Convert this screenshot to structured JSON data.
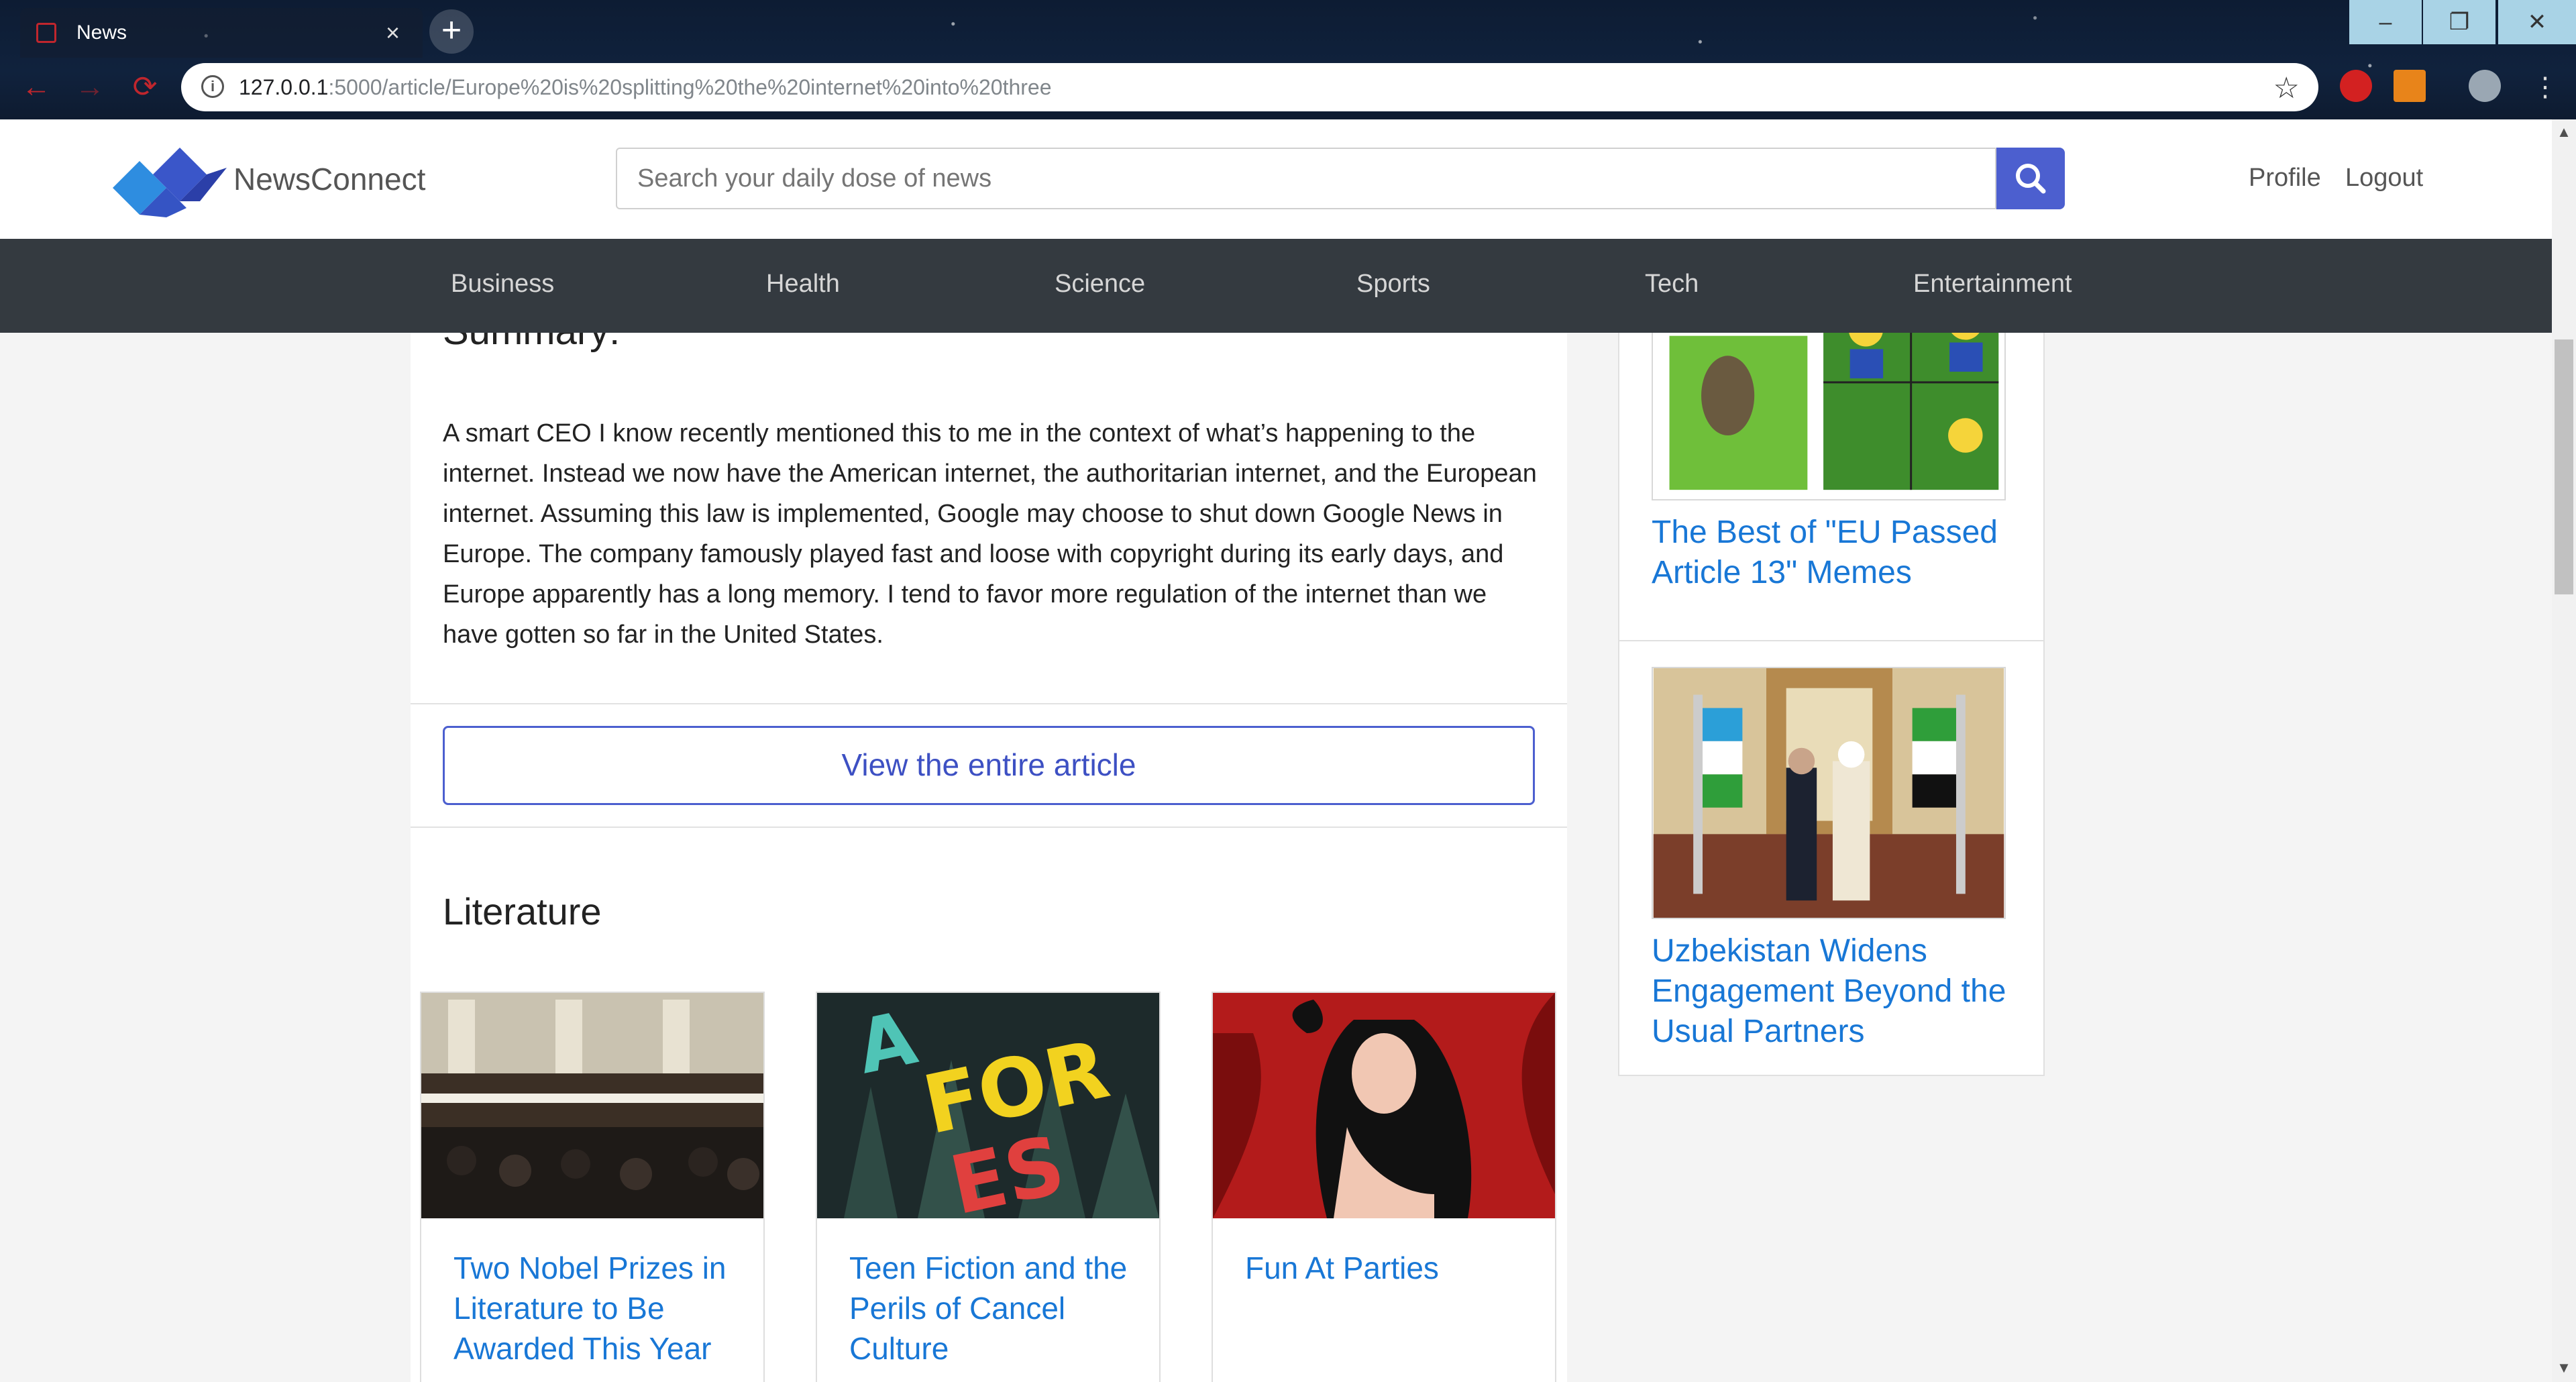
{
  "browser": {
    "tab_title": "News",
    "tab_close": "×",
    "new_tab": "+",
    "url_host": "127.0.0.1",
    "url_path": ":5000/article/Europe%20is%20splitting%20the%20internet%20into%20three",
    "window_min": "–",
    "window_max": "❐",
    "window_close": "✕"
  },
  "header": {
    "brand": "NewsConnect",
    "search_placeholder": "Search your daily dose of news",
    "links": [
      "Profile",
      "Logout"
    ]
  },
  "nav": [
    "Business",
    "Health",
    "Science",
    "Sports",
    "Tech",
    "Entertainment"
  ],
  "article": {
    "summary_heading": "Summary:",
    "summary_text": "A smart CEO I know recently mentioned this to me in the context of what’s happening to the internet. Instead we now have the American internet, the authoritarian internet, and the European internet. Assuming this law is implemented, Google may choose to shut down Google News in Europe. The company famously played fast and loose with copyright during its early days, and Europe apparently has a long memory. I tend to favor more regulation of the internet than we have gotten so far in the United States.",
    "view_button": "View the entire article"
  },
  "literature": {
    "heading": "Literature",
    "cards": [
      {
        "title": "Two Nobel Prizes in Literature to Be Awarded This Year"
      },
      {
        "title": "Teen Fiction and the Perils of Cancel Culture"
      },
      {
        "title": "Fun At Parties"
      }
    ]
  },
  "sidebar": {
    "items": [
      {
        "title": "The Best of \"EU Passed Article 13\" Memes"
      },
      {
        "title": "Uzbekistan Widens Engagement Beyond the Usual Partners"
      }
    ]
  },
  "colors": {
    "accent": "#4c5fcf",
    "link": "#1877d6",
    "navbar": "#343a40"
  }
}
